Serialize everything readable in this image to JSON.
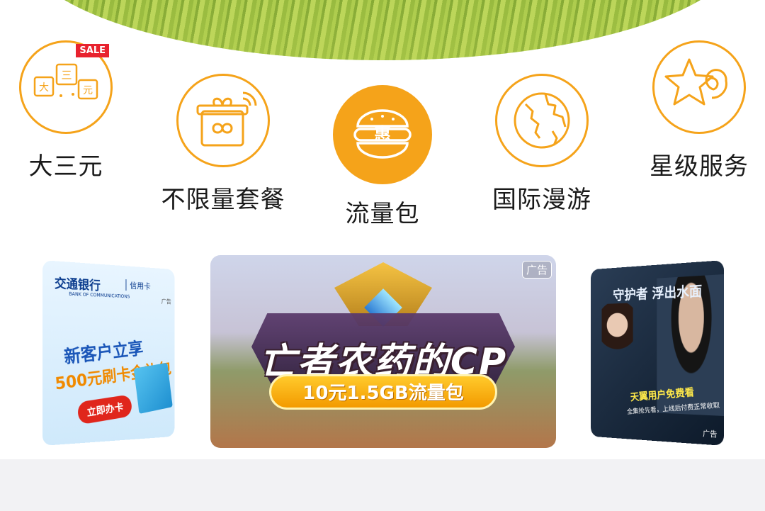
{
  "categories": [
    {
      "label": "大三元",
      "icon": "dice-icon",
      "badge": "SALE"
    },
    {
      "label": "不限量套餐",
      "icon": "gift-infinity-icon"
    },
    {
      "label": "流量包",
      "icon": "burger-hui-icon",
      "icon_text": "惠"
    },
    {
      "label": "国际漫游",
      "icon": "globe-icon"
    },
    {
      "label": "星级服务",
      "icon": "star-icon"
    }
  ],
  "dice_chars": [
    "大",
    "三",
    "元"
  ],
  "banners": {
    "left": {
      "bank": "交通银行",
      "bank_en": "BANK OF COMMUNICATIONS",
      "card_type": "信用卡",
      "promo_line1": "新客户立享",
      "promo_line2": "500元刷卡金礼包",
      "button": "立即办卡",
      "ad": "广告"
    },
    "center": {
      "ad": "广告",
      "title": "亡者农药的CP",
      "price": "10元1.5GB流量包"
    },
    "right": {
      "title": "守护者 浮出水面",
      "promo_line1": "天翼用户免费看",
      "promo_line2": "全集抢先看，上线后付费正常收取",
      "ad": "广告"
    }
  },
  "colors": {
    "accent": "#f5a31a",
    "sale_red": "#e8222e"
  }
}
